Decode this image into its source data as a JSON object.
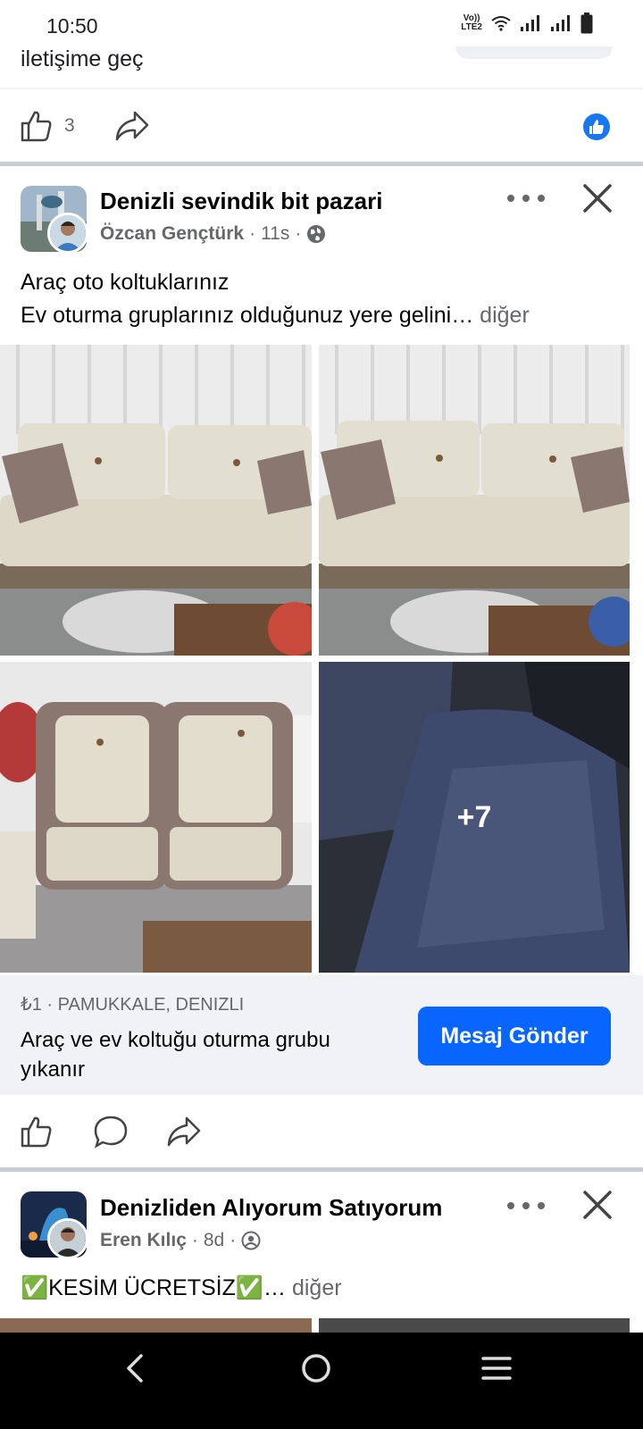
{
  "status_bar": {
    "time": "10:50",
    "volte_top": "Vo))",
    "volte_bottom": "LTE2",
    "icons": [
      "wifi-icon",
      "signal-icon",
      "signal-icon",
      "battery-icon"
    ]
  },
  "prev_post": {
    "text": "iletişime geç",
    "like_count": "3"
  },
  "post": {
    "group_name": "Denizli sevindik bit pazari",
    "author": "Özcan Gençtürk",
    "time": "11s",
    "audience_icon": "globe-icon",
    "body_line1": "Araç oto koltuklarınız",
    "body_line2": "Ev oturma gruplarınız olduğunuz yere gelini…",
    "more": "diğer",
    "extra_photos": "+7",
    "marketplace": {
      "price_location": "₺1 · PAMUKKALE, DENIZLI",
      "title": "Araç ve ev koltuğu oturma grubu yıkanır",
      "button": "Mesaj Gönder"
    }
  },
  "next_post": {
    "group_name": "Denizliden Alıyorum Satıyorum",
    "author": "Eren Kılıç",
    "time": "8d",
    "audience_icon": "friends-icon",
    "body": "✅KESİM ÜCRETSİZ✅…",
    "more": "diğer"
  },
  "nav": [
    "back-icon",
    "home-icon",
    "recents-icon"
  ],
  "colors": {
    "accent": "#0866ff",
    "like_badge": "#1877f2",
    "secondary_text": "#65676b",
    "divider": "#c9ccd1"
  }
}
